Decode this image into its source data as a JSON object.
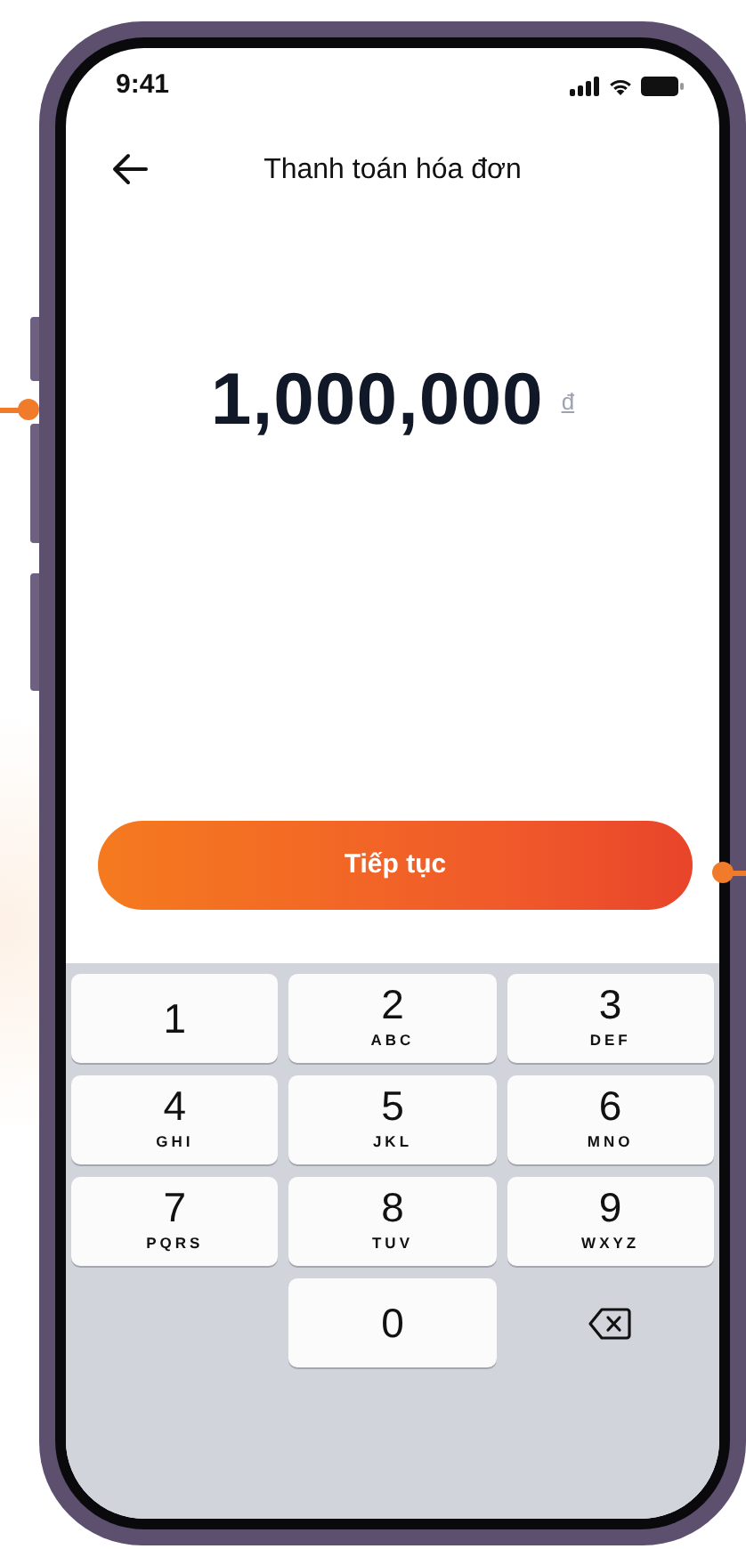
{
  "status_bar": {
    "time": "9:41"
  },
  "header": {
    "title": "Thanh toán hóa đơn"
  },
  "amount": {
    "value": "1,000,000",
    "currency": "đ"
  },
  "primary_button": {
    "label": "Tiếp tục"
  },
  "keypad": {
    "keys": [
      {
        "kind": "digit",
        "digit": "1"
      },
      {
        "kind": "digit",
        "digit": "2",
        "letters": "ABC"
      },
      {
        "kind": "digit",
        "digit": "3",
        "letters": "DEF"
      },
      {
        "kind": "digit",
        "digit": "4",
        "letters": "GHI"
      },
      {
        "kind": "digit",
        "digit": "5",
        "letters": "JKL"
      },
      {
        "kind": "digit",
        "digit": "6",
        "letters": "MNO"
      },
      {
        "kind": "digit",
        "digit": "7",
        "letters": "PQRS"
      },
      {
        "kind": "digit",
        "digit": "8",
        "letters": "TUV"
      },
      {
        "kind": "digit",
        "digit": "9",
        "letters": "WXYZ"
      },
      {
        "kind": "blank"
      },
      {
        "kind": "digit",
        "digit": "0"
      },
      {
        "kind": "delete"
      }
    ]
  }
}
